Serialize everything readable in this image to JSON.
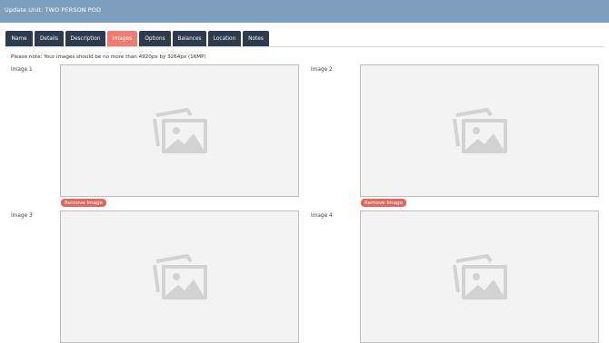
{
  "header": {
    "title": "Update Unit: TWO PERSON POD"
  },
  "tabs": [
    {
      "label": "Name",
      "active": false
    },
    {
      "label": "Details",
      "active": false
    },
    {
      "label": "Description",
      "active": false
    },
    {
      "label": "Images",
      "active": true
    },
    {
      "label": "Options",
      "active": false
    },
    {
      "label": "Balances",
      "active": false
    },
    {
      "label": "Location",
      "active": false
    },
    {
      "label": "Notes",
      "active": false
    }
  ],
  "note": "Please note: Your images should be no more than 4920px by 3264px (16MP)",
  "images": [
    {
      "label": "Image 1",
      "remove_label": "Remove Image"
    },
    {
      "label": "Image 2",
      "remove_label": "Remove Image"
    },
    {
      "label": "Image 3"
    },
    {
      "label": "Image 4"
    }
  ],
  "colors": {
    "header_bg": "#7f9fbf",
    "tab_bg": "#2e3a4d",
    "tab_active_bg": "#ee7c72",
    "remove_button_bg": "#e06860"
  }
}
